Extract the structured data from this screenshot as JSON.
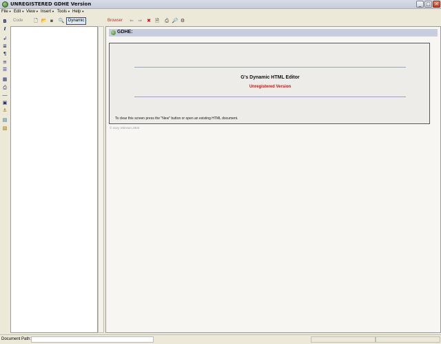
{
  "window": {
    "title": "UNREGISTERED GDHE Version",
    "controls": {
      "minimize": "_",
      "maximize": "□",
      "close": "✕"
    }
  },
  "menubar": {
    "items": [
      {
        "label": "File"
      },
      {
        "label": "Edit"
      },
      {
        "label": "View"
      },
      {
        "label": "Insert"
      },
      {
        "label": "Tools"
      },
      {
        "label": "Help"
      }
    ]
  },
  "left_toolbar": {
    "icons": [
      "bold-icon",
      "italic-icon",
      "wrap-icon",
      "list-icon",
      "paragraph-icon",
      "align-icon",
      "justify-icon",
      "table-icon",
      "form-icon",
      "line-icon",
      "image-library-icon",
      "anchor-icon",
      "picture-icon",
      "insert-object-icon"
    ]
  },
  "code_panel": {
    "label": "Code",
    "toolbar": {
      "icons": [
        "new-icon",
        "open-icon",
        "save-icon",
        "zoom-icon"
      ],
      "dynamic_label": "Dynamic"
    }
  },
  "browser_panel": {
    "label": "Browser",
    "toolbar": {
      "icons": [
        "back-icon",
        "forward-icon",
        "stop-icon",
        "page-icon",
        "print-icon",
        "print-preview-icon",
        "settings-icon"
      ]
    },
    "header_title": "GDHE:",
    "splash": {
      "title": "G's Dynamic HTML Editor",
      "unregistered": "Unregistered Version",
      "note": "To clear this screen press the \"New\" button or open an existing HTML document."
    },
    "copyright": "© Gary Stimson 2003"
  },
  "statusbar": {
    "document_path_label": "Document Path:",
    "document_path_value": ""
  },
  "colors": {
    "accent_red": "#d01010",
    "header_blue": "#c8cde0",
    "chrome": "#ece9d8"
  }
}
